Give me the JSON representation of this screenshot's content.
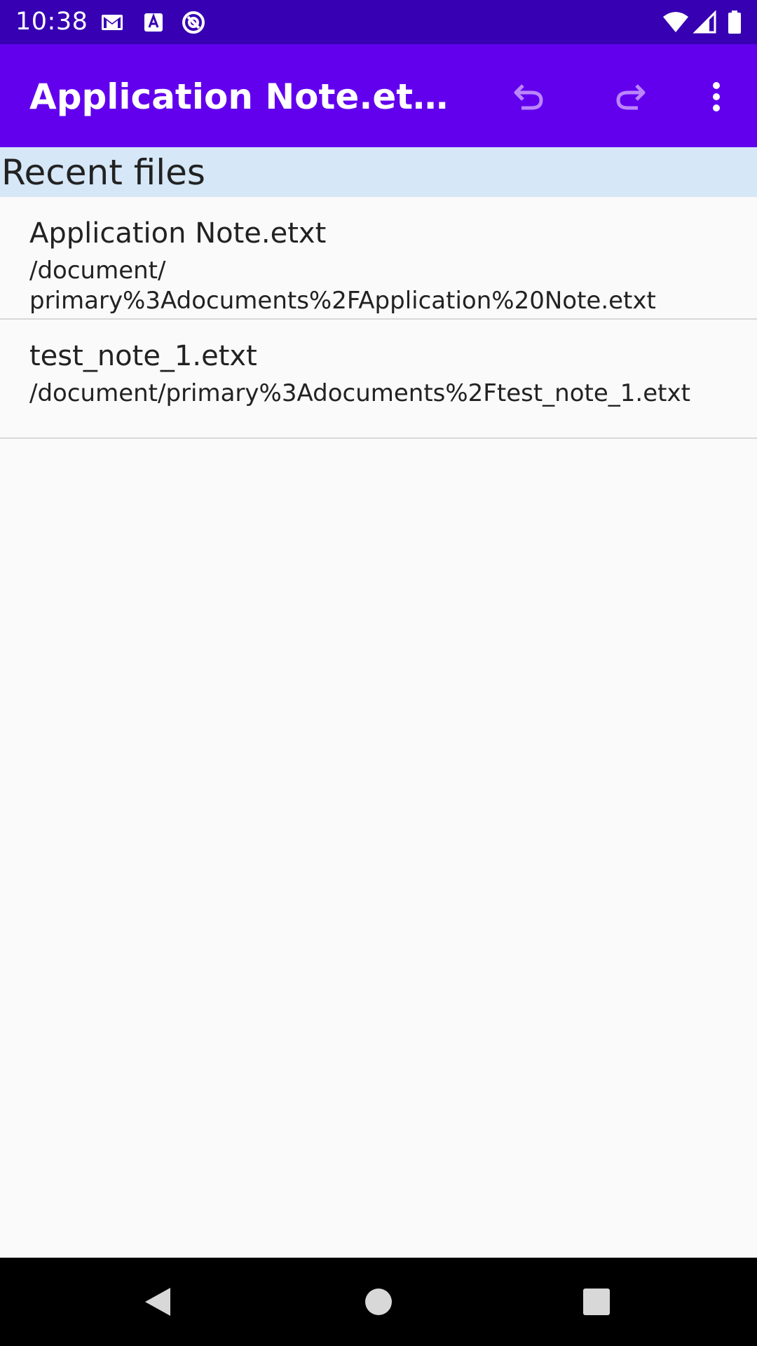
{
  "status_bar": {
    "time": "10:38",
    "left_icons": [
      "gmail-icon",
      "font-a-icon",
      "at-sign-icon"
    ],
    "right_icons": [
      "wifi-icon",
      "cellular-signal-icon",
      "battery-icon"
    ]
  },
  "app_bar": {
    "title": "Application Note.etxt - Y...",
    "actions": [
      "undo-icon",
      "redo-icon",
      "more-vert-icon"
    ]
  },
  "recent": {
    "header": "Recent files",
    "items": [
      {
        "name": "Application Note.etxt",
        "path_line_1": "/document/",
        "path_line_2": "primary%3Adocuments%2FApplication%20Note.etxt"
      },
      {
        "name": "test_note_1.etxt",
        "path_line_1": "/document/primary%3Adocuments%2Ftest_note_1.etxt"
      }
    ]
  },
  "nav_bar": {
    "buttons": [
      "back-icon",
      "home-icon",
      "recents-icon"
    ]
  },
  "colors": {
    "status_bar": "#3700b3",
    "app_bar": "#6200ee",
    "header_bg": "#d6e7f7",
    "action_icon": "#bb86fc",
    "background": "#fafafa"
  }
}
